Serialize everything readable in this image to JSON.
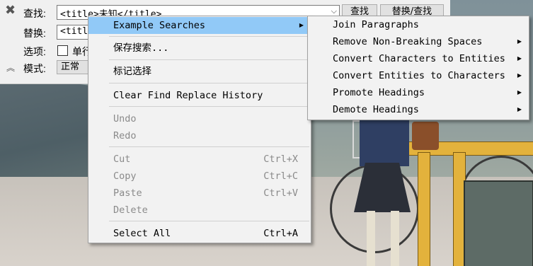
{
  "panel": {
    "find_label": "查找:",
    "find_value": "<title>未知</title>",
    "replace_label": "替换:",
    "replace_value": "<titl",
    "options_label": "选项:",
    "single_word_label": "单行",
    "mode_label": "模式:",
    "mode_value": "正常",
    "find_button": "查找",
    "replace_find_button": "替换/查找"
  },
  "context_menu": {
    "items": [
      {
        "label": "Example Searches"
      },
      {
        "label": "保存搜索..."
      },
      {
        "label": "标记选择"
      },
      {
        "label": "Clear Find Replace History"
      },
      {
        "label": "Undo"
      },
      {
        "label": "Redo"
      },
      {
        "label": "Cut",
        "shortcut": "Ctrl+X"
      },
      {
        "label": "Copy",
        "shortcut": "Ctrl+C"
      },
      {
        "label": "Paste",
        "shortcut": "Ctrl+V"
      },
      {
        "label": "Delete"
      },
      {
        "label": "Select All",
        "shortcut": "Ctrl+A"
      }
    ]
  },
  "submenu": {
    "items": [
      {
        "label": "Join Paragraphs"
      },
      {
        "label": "Remove Non-Breaking Spaces"
      },
      {
        "label": "Convert Characters to Entities"
      },
      {
        "label": "Convert Entities to Characters"
      },
      {
        "label": "Promote Headings"
      },
      {
        "label": "Demote Headings"
      }
    ]
  },
  "icons": {
    "close": "close-icon",
    "collapse": "double-chevron-up-icon",
    "submenu_arrow": "triangle-right-icon",
    "dropdown": "chevron-down-icon"
  },
  "colors": {
    "highlight": "#91c9f7",
    "menu_bg": "#f2f2f2",
    "disabled_text": "#8a8a8a"
  }
}
